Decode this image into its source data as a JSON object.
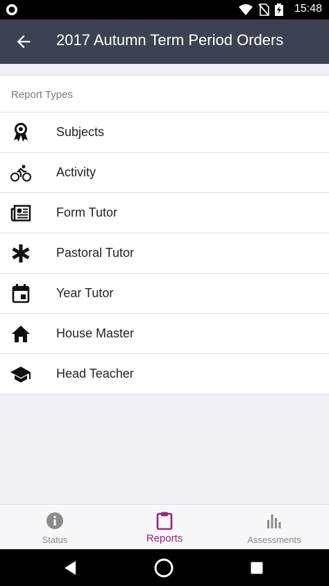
{
  "status_bar": {
    "time": "15:48"
  },
  "app_bar": {
    "title": "2017 Autumn Term Period Orders"
  },
  "section": {
    "header": "Report Types"
  },
  "report_types": [
    {
      "label": "Subjects",
      "icon": "award-ribbon-icon"
    },
    {
      "label": "Activity",
      "icon": "bicycle-icon"
    },
    {
      "label": "Form Tutor",
      "icon": "newspaper-icon"
    },
    {
      "label": "Pastoral Tutor",
      "icon": "asterisk-icon"
    },
    {
      "label": "Year Tutor",
      "icon": "calendar-icon"
    },
    {
      "label": "House Master",
      "icon": "home-icon"
    },
    {
      "label": "Head Teacher",
      "icon": "graduation-cap-icon"
    }
  ],
  "tabs": [
    {
      "label": "Status",
      "icon": "info-icon",
      "active": false
    },
    {
      "label": "Reports",
      "icon": "clipboard-icon",
      "active": true
    },
    {
      "label": "Assessments",
      "icon": "bar-chart-icon",
      "active": false
    }
  ],
  "colors": {
    "app_bar": "#3c4252",
    "accent": "#9c1f82",
    "background": "#efeff4"
  }
}
